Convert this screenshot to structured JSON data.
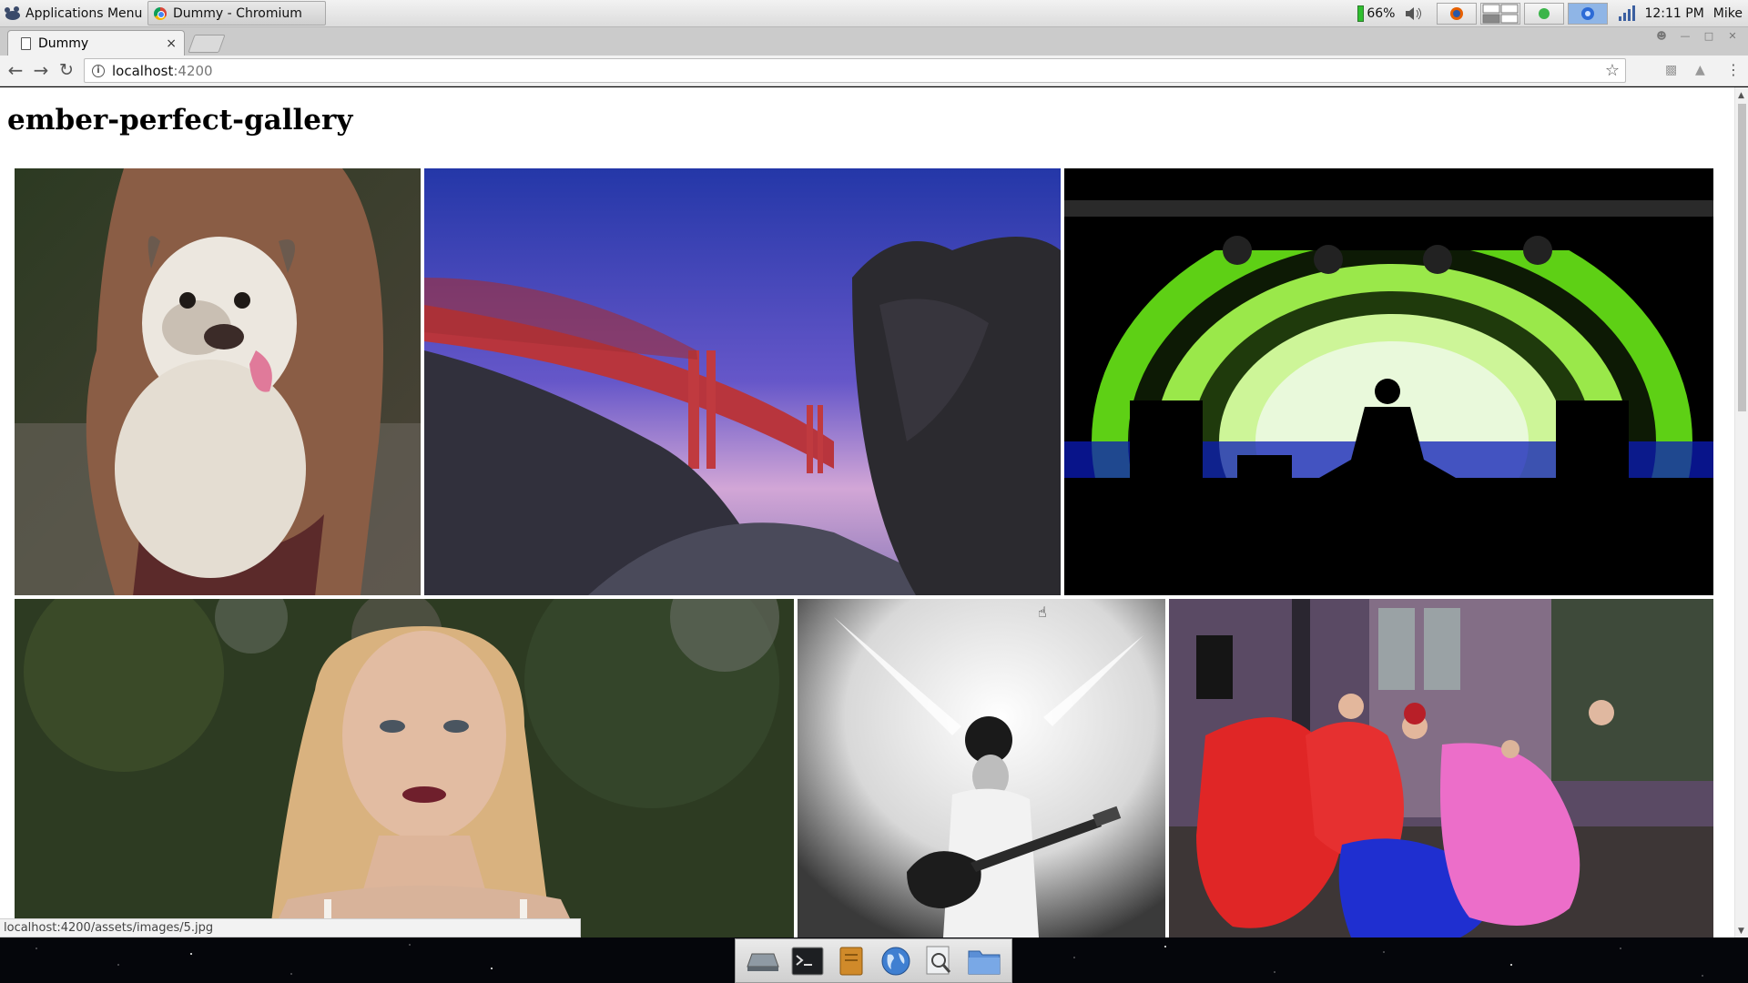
{
  "panel": {
    "app_menu_label": "Applications Menu",
    "task_window_title": "Dummy - Chromium",
    "battery_percent": "66%",
    "clock": "12:11 PM",
    "user": "Mike"
  },
  "browser": {
    "tab_title": "Dummy",
    "tab_close": "×",
    "url_host": "localhost",
    "url_port": ":4200",
    "status_url": "localhost:4200/assets/images/5.jpg"
  },
  "page": {
    "title": "ember-perfect-gallery",
    "photos": [
      {
        "name": "bulldog-photo",
        "colors": [
          "#6b5142",
          "#e9e3da",
          "#2e2a22"
        ]
      },
      {
        "name": "golden-gate-photo",
        "colors": [
          "#3b49b8",
          "#b63b3f",
          "#2a2630"
        ]
      },
      {
        "name": "dj-stage-photo",
        "colors": [
          "#000000",
          "#7ee02c",
          "#1a2bd6"
        ]
      },
      {
        "name": "portrait-photo",
        "colors": [
          "#28361f",
          "#d9ae8b",
          "#e6d4ae"
        ]
      },
      {
        "name": "guitarist-photo",
        "colors": [
          "#ffffff",
          "#9a9a9a",
          "#1a1a1a"
        ]
      },
      {
        "name": "dancers-photo",
        "colors": [
          "#6a4e6e",
          "#e82b2b",
          "#e569bd"
        ]
      }
    ]
  },
  "dock": {
    "items": [
      "drive-icon",
      "terminal-icon",
      "notes-icon",
      "globe-icon",
      "search-icon",
      "folder-icon"
    ]
  }
}
